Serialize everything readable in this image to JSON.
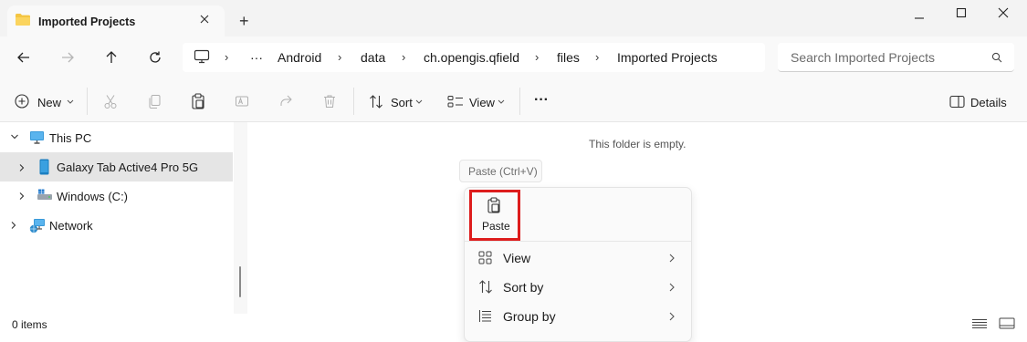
{
  "window": {
    "tab_title": "Imported Projects",
    "new_tab_symbol": "+",
    "controls": [
      "minimize",
      "maximize",
      "close"
    ]
  },
  "navigation": {
    "breadcrumb_more": "···",
    "breadcrumbs": [
      "Android",
      "data",
      "ch.opengis.qfield",
      "files",
      "Imported Projects"
    ],
    "search_placeholder": "Search Imported Projects"
  },
  "toolbar": {
    "new_label": "New",
    "sort_label": "Sort",
    "view_label": "View",
    "more_label": "···",
    "details_label": "Details"
  },
  "sidebar": {
    "items": [
      {
        "label": "This PC",
        "icon": "monitor-icon",
        "expanded": true
      },
      {
        "label": "Galaxy Tab Active4 Pro 5G",
        "icon": "tablet-icon",
        "selected": true
      },
      {
        "label": "Windows (C:)",
        "icon": "drive-icon"
      },
      {
        "label": "Network",
        "icon": "network-icon"
      }
    ]
  },
  "content": {
    "empty_message": "This folder is empty."
  },
  "context_menu": {
    "tooltip": "Paste (Ctrl+V)",
    "paste_label": "Paste",
    "items": [
      {
        "label": "View",
        "icon": "grid-icon"
      },
      {
        "label": "Sort by",
        "icon": "sort-icon"
      },
      {
        "label": "Group by",
        "icon": "group-icon"
      }
    ]
  },
  "status": {
    "item_count": "0 items"
  },
  "colors": {
    "highlight_border": "#dd1c1c",
    "folder": "#f4c542",
    "selection": "#e5e5e5"
  }
}
